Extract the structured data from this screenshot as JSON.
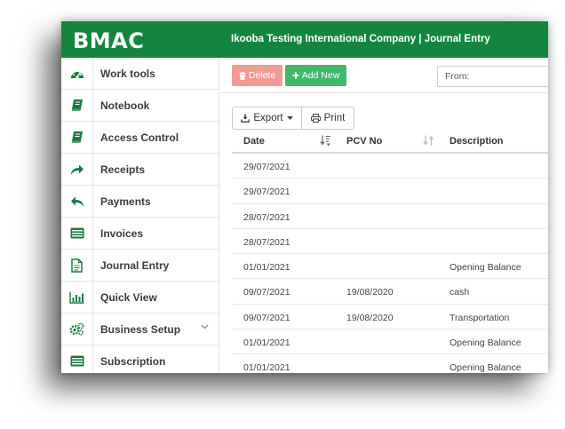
{
  "brand": "BMAC",
  "header": {
    "company_title": "Ikooba Testing International Company | Journal Entry"
  },
  "colors": {
    "brand_green": "#13853f",
    "icon_green": "#1e7a45",
    "delete_red": "#f09b96",
    "add_green": "#41b86b"
  },
  "sidebar": {
    "items": [
      {
        "label": "Work tools",
        "icon": "dashboard-icon"
      },
      {
        "label": "Notebook",
        "icon": "book-icon"
      },
      {
        "label": "Access Control",
        "icon": "book-icon"
      },
      {
        "label": "Receipts",
        "icon": "share-arrow-icon"
      },
      {
        "label": "Payments",
        "icon": "reply-arrow-icon"
      },
      {
        "label": "Invoices",
        "icon": "list-card-icon"
      },
      {
        "label": "Journal Entry",
        "icon": "document-icon"
      },
      {
        "label": "Quick View",
        "icon": "bar-chart-icon"
      },
      {
        "label": "Business Setup",
        "icon": "gears-icon"
      },
      {
        "label": "Subscription",
        "icon": "list-card-icon"
      }
    ]
  },
  "toolbar": {
    "delete_label": "Delete",
    "add_label": "Add New",
    "from_placeholder": "From:",
    "export_label": "Export",
    "print_label": "Print"
  },
  "table": {
    "columns": [
      "Date",
      "PCV No",
      "Description"
    ],
    "rows": [
      {
        "date": "29/07/2021",
        "pcv": "",
        "desc": ""
      },
      {
        "date": "29/07/2021",
        "pcv": "",
        "desc": ""
      },
      {
        "date": "28/07/2021",
        "pcv": "",
        "desc": ""
      },
      {
        "date": "28/07/2021",
        "pcv": "",
        "desc": ""
      },
      {
        "date": "01/01/2021",
        "pcv": "",
        "desc": "Opening Balance"
      },
      {
        "date": "09/07/2021",
        "pcv": "19/08/2020",
        "desc": "cash"
      },
      {
        "date": "09/07/2021",
        "pcv": "19/08/2020",
        "desc": "Transportation"
      },
      {
        "date": "01/01/2021",
        "pcv": "",
        "desc": "Opening Balance"
      },
      {
        "date": "01/01/2021",
        "pcv": "",
        "desc": "Opening Balance"
      }
    ]
  }
}
